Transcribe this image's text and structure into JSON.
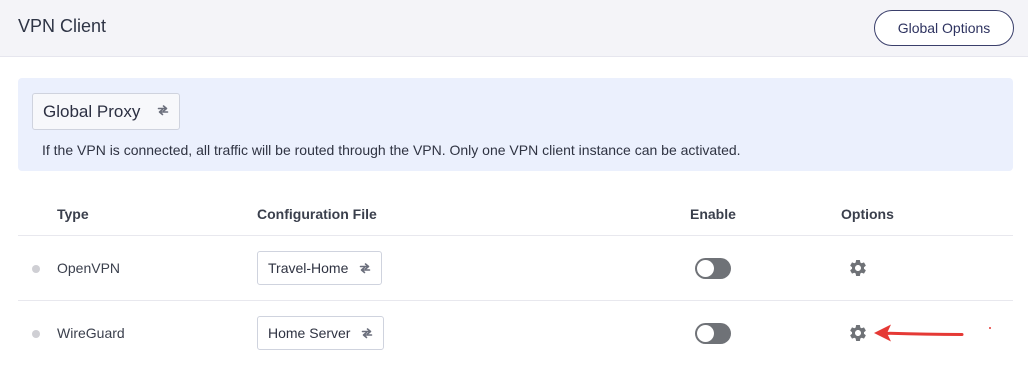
{
  "header": {
    "title": "VPN Client",
    "global_options_label": "Global Options"
  },
  "proxy": {
    "mode": "Global Proxy",
    "description": "If the VPN is connected, all traffic will be routed through the VPN. Only one VPN client instance can be activated."
  },
  "table": {
    "columns": {
      "type": "Type",
      "config": "Configuration File",
      "enable": "Enable",
      "options": "Options"
    },
    "rows": [
      {
        "type": "OpenVPN",
        "config_file": "Travel-Home",
        "enabled": false
      },
      {
        "type": "WireGuard",
        "config_file": "Home Server",
        "enabled": false
      }
    ]
  },
  "icons": {
    "select_indicator": "swap-arrows-icon",
    "options": "gear-icon",
    "annotation": "red-arrow-icon"
  },
  "colors": {
    "accent": "#3a3f6b",
    "panel_bg": "#ebf0fd",
    "toggle_off": "#6f7277",
    "annotation": "#e53935"
  }
}
